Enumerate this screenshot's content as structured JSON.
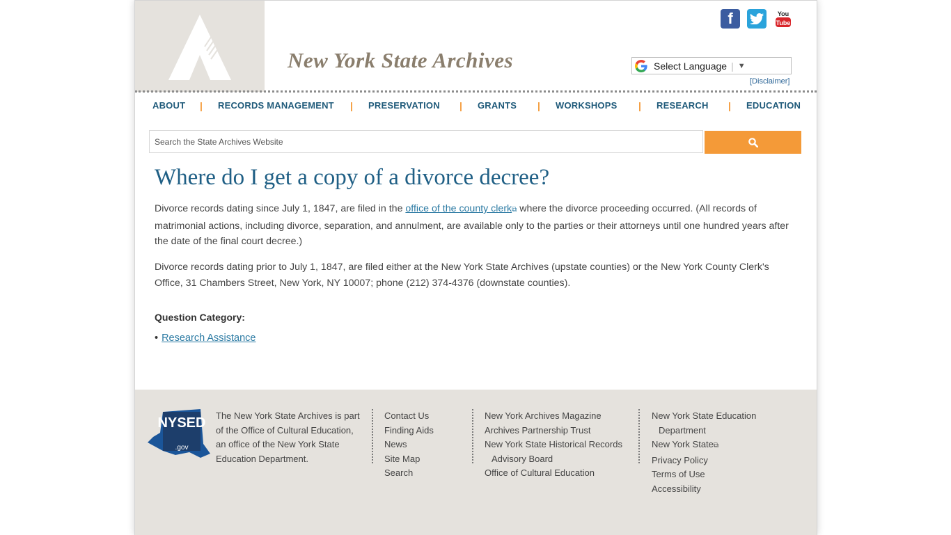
{
  "header": {
    "site_title": "New York State Archives",
    "language_select": "Select Language",
    "disclaimer": "[Disclaimer]",
    "social": [
      "facebook-icon",
      "twitter-icon",
      "youtube-icon"
    ]
  },
  "nav": {
    "items": [
      "ABOUT",
      "RECORDS MANAGEMENT",
      "PRESERVATION",
      "GRANTS",
      "WORKSHOPS",
      "RESEARCH",
      "EDUCATION"
    ]
  },
  "search": {
    "placeholder": "Search the State Archives Website"
  },
  "main": {
    "title": "Where do I get a copy of a divorce decree?",
    "para1_before": "Divorce records dating since July 1, 1847, are filed in the ",
    "para1_link": "office of the county clerk",
    "para1_after": " where the divorce proceeding occurred. (All records of matrimonial actions, including divorce, separation, and annulment, are available only to the parties or their attorneys until one hundred years after the date of the final court decree.)",
    "para2": "Divorce records dating prior to July 1, 1847, are filed either at the New York State Archives (upstate counties) or the New York County Clerk's Office, 31 Chambers Street, New York, NY 10007; phone (212) 374-4376 (downstate counties).",
    "question_category_label": "Question Category:",
    "categories": [
      "Research Assistance"
    ]
  },
  "footer": {
    "logo_text": "NYSED",
    "logo_sub": ".gov",
    "about": "The New York State Archives is part of the Office of Cultural Education, an office of the New York State Education Department.",
    "col1": [
      "Contact Us",
      "Finding Aids",
      "News",
      "Site Map",
      "Search"
    ],
    "col2": [
      "New York Archives Magazine",
      "Archives Partnership Trust",
      "New York State Historical Records",
      "Advisory Board",
      "Office of Cultural Education"
    ],
    "col3": [
      "New York State Education",
      "Department",
      "New York State",
      "Privacy Policy",
      "Terms of Use",
      "Accessibility"
    ]
  },
  "colors": {
    "accent_orange": "#f49a38",
    "title_blue": "#1f5f85",
    "nav_blue": "#1f5a7a",
    "link_blue": "#2b7aa3",
    "beige": "#e5e2dd"
  }
}
